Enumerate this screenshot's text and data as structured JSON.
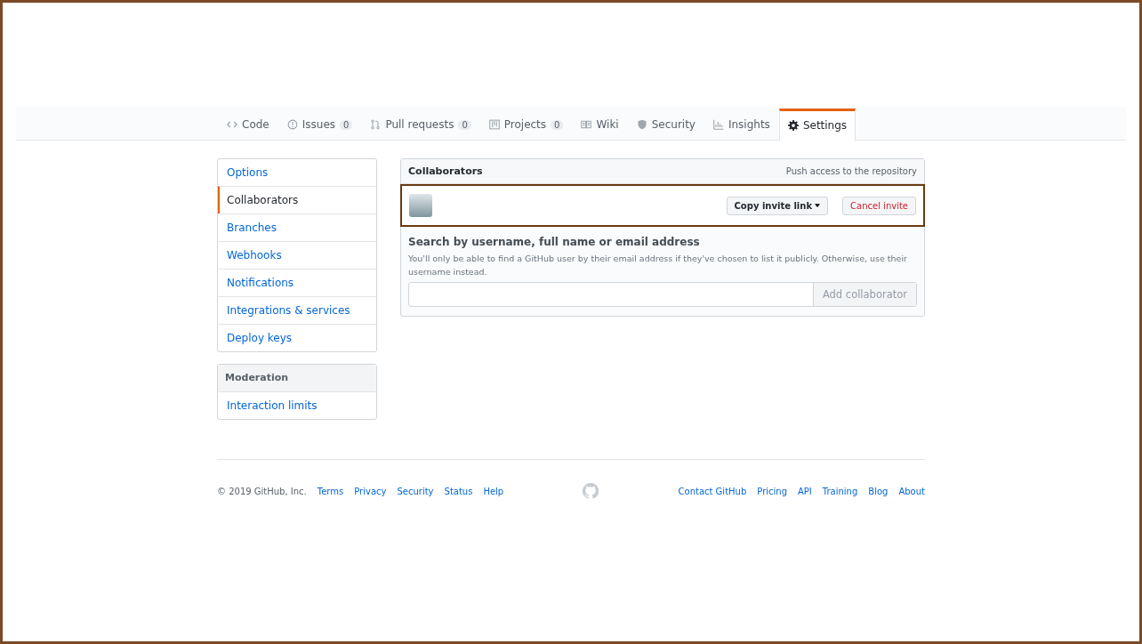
{
  "tabs": [
    {
      "kind": "code",
      "label": "Code",
      "selected": false
    },
    {
      "kind": "issue",
      "label": "Issues",
      "counter": "0",
      "selected": false
    },
    {
      "kind": "pull",
      "label": "Pull requests",
      "counter": "0",
      "selected": false
    },
    {
      "kind": "project",
      "label": "Projects",
      "counter": "0",
      "selected": false
    },
    {
      "kind": "book",
      "label": "Wiki",
      "selected": false
    },
    {
      "kind": "shield",
      "label": "Security",
      "selected": false
    },
    {
      "kind": "graph",
      "label": "Insights",
      "selected": false
    },
    {
      "kind": "gear",
      "label": "Settings",
      "selected": true
    }
  ],
  "sidebar": {
    "items": [
      {
        "label": "Options",
        "selected": false
      },
      {
        "label": "Collaborators",
        "selected": true
      },
      {
        "label": "Branches",
        "selected": false
      },
      {
        "label": "Webhooks",
        "selected": false
      },
      {
        "label": "Notifications",
        "selected": false
      },
      {
        "label": "Integrations & services",
        "selected": false
      },
      {
        "label": "Deploy keys",
        "selected": false
      }
    ]
  },
  "moderation": {
    "heading": "Moderation",
    "items": [
      {
        "label": "Interaction limits",
        "selected": false
      }
    ]
  },
  "collaborators": {
    "title": "Collaborators",
    "note": "Push access to the repository",
    "invite": {
      "highlighted": true,
      "copy_button": "Copy invite link",
      "cancel_button": "Cancel invite"
    },
    "search": {
      "heading": "Search by username, full name or email address",
      "help": "You'll only be able to find a GitHub user by their email address if they've chosen to list it publicly. Otherwise, use their username instead.",
      "button": "Add collaborator",
      "button_disabled": true
    }
  },
  "footer": {
    "copyright": "© 2019 GitHub, Inc.",
    "left_links": [
      "Terms",
      "Privacy",
      "Security",
      "Status",
      "Help"
    ],
    "right_links": [
      "Contact GitHub",
      "Pricing",
      "API",
      "Training",
      "Blog",
      "About"
    ]
  }
}
